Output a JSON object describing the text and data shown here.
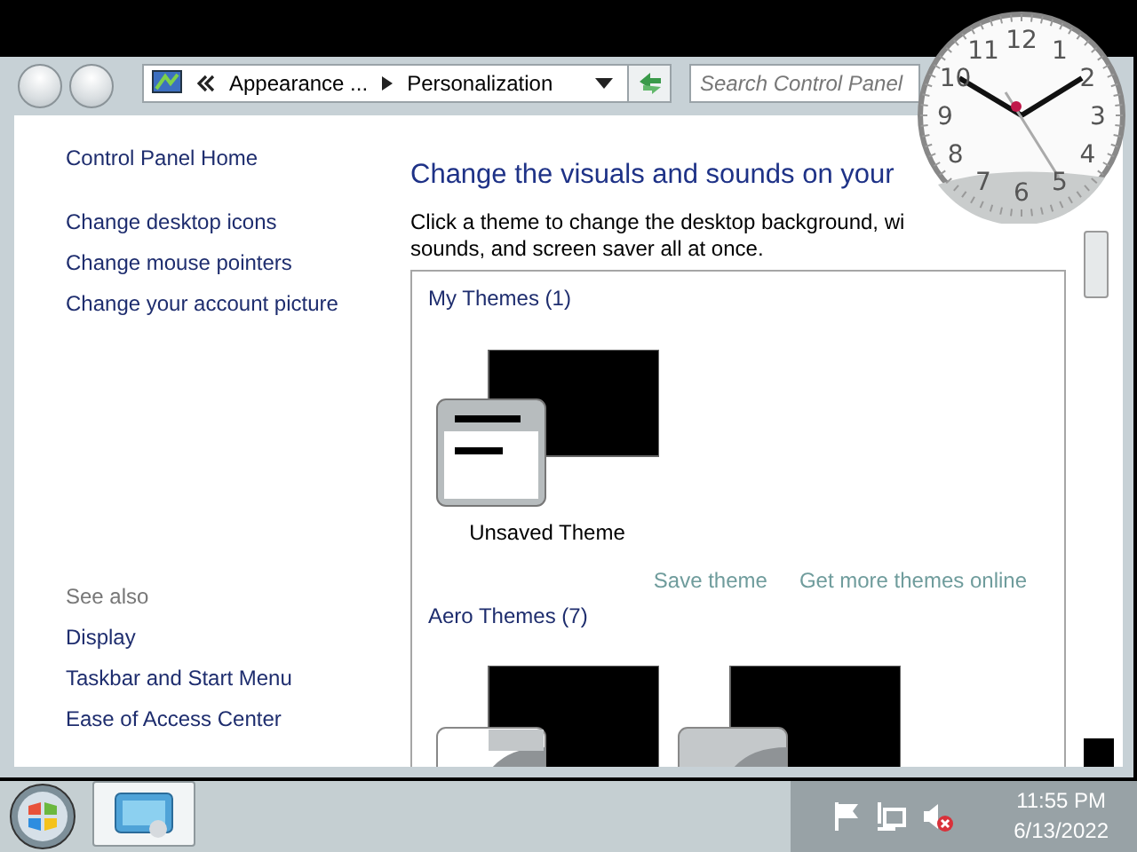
{
  "toolbar": {
    "breadcrumb": [
      {
        "label": "Appearance ..."
      },
      {
        "label": "Personalization"
      }
    ],
    "search": {
      "placeholder": "Search Control Panel"
    }
  },
  "sidebar": {
    "links": [
      "Control Panel Home",
      "Change desktop icons",
      "Change mouse pointers",
      "Change your account picture"
    ],
    "see_also_title": "See also",
    "see_also": [
      "Display",
      "Taskbar and Start Menu",
      "Ease of Access Center"
    ]
  },
  "content": {
    "heading": "Change the visuals and sounds on your",
    "description_lines": [
      "Click a theme to change the desktop background, wi",
      "sounds, and screen saver all at once."
    ],
    "groups": [
      {
        "title": "My Themes (1)",
        "themes": [
          {
            "kind": "custom",
            "label": "Unsaved Theme"
          }
        ],
        "links": [
          "Save theme",
          "Get more themes online"
        ]
      },
      {
        "title": "Aero Themes (7)",
        "themes": [
          {
            "kind": "aero"
          },
          {
            "kind": "aero-teal"
          }
        ]
      }
    ]
  },
  "gadget": {
    "clock_numbers": [
      "11",
      "12",
      "1",
      "10",
      "2",
      "9",
      "3",
      "8",
      "4",
      "7",
      "6",
      "5"
    ]
  },
  "taskbar": {
    "time": "11:55 PM",
    "date": "6/13/2022"
  }
}
